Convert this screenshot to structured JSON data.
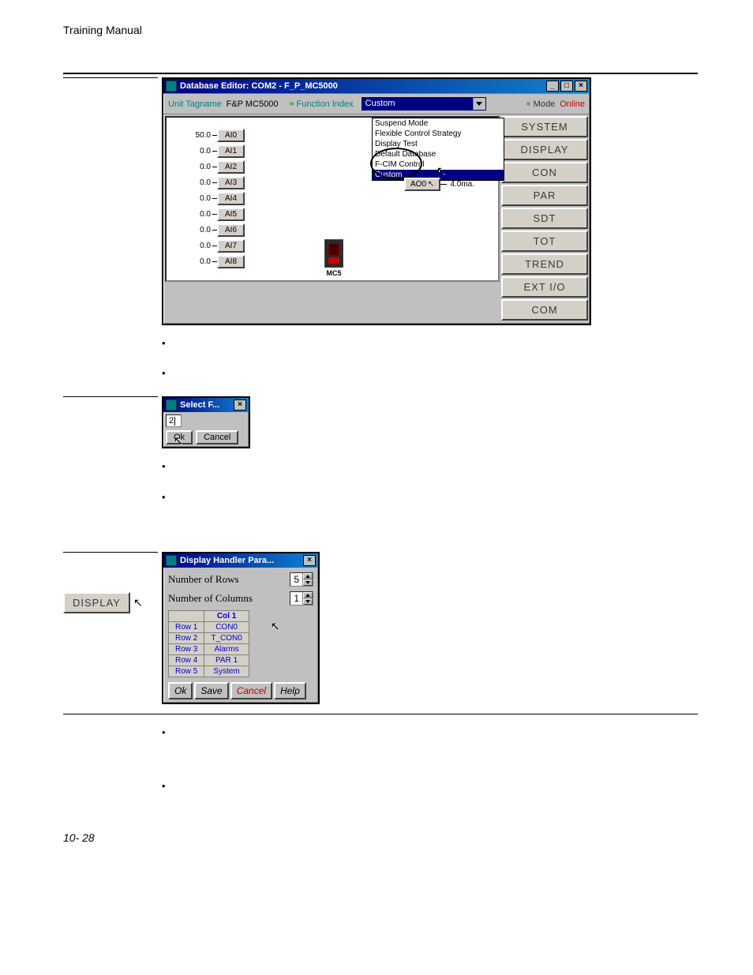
{
  "header": "Training Manual",
  "page_number": "10- 28",
  "dbe": {
    "title": "Database Editor: COM2 - F_P_MC5000",
    "unit_tagname_label": "Unit Tagname",
    "unit_tagname_value": "F&P MC5000",
    "function_index_label": "Function Index",
    "combo_selected": "Custom",
    "mode_label": "Mode",
    "mode_value": "Online",
    "ai": [
      {
        "val": "50.0",
        "name": "AI0"
      },
      {
        "val": "0.0",
        "name": "AI1"
      },
      {
        "val": "0.0",
        "name": "AI2"
      },
      {
        "val": "0.0",
        "name": "AI3"
      },
      {
        "val": "0.0",
        "name": "AI4"
      },
      {
        "val": "0.0",
        "name": "AI5"
      },
      {
        "val": "0.0",
        "name": "AI6"
      },
      {
        "val": "0.0",
        "name": "AI7"
      },
      {
        "val": "0.0",
        "name": "AI8"
      }
    ],
    "dropdown_options": [
      "Suspend Mode",
      "Flexible Control Strategy",
      "Display Test",
      "Default Database",
      "F-CIM Control",
      "Custom"
    ],
    "ao": {
      "name": "AO0",
      "val": "4.0ma."
    },
    "mc5_label": "MC5",
    "side_buttons": [
      "SYSTEM",
      "DISPLAY",
      "CON",
      "PAR",
      "SDT",
      "TOT",
      "TREND",
      "EXT I/O",
      "COM"
    ]
  },
  "sel": {
    "title": "Select F...",
    "value": "2",
    "ok": "Ok",
    "cancel": "Cancel"
  },
  "display_button": "DISPLAY",
  "dhp": {
    "title": "Display Handler Para...",
    "rows_label": "Number of Rows",
    "rows_value": "5",
    "cols_label": "Number of Columns",
    "cols_value": "1",
    "col_header": "Col 1",
    "rows": [
      {
        "r": "Row 1",
        "c": "CON0"
      },
      {
        "r": "Row 2",
        "c": "T_CON0"
      },
      {
        "r": "Row 3",
        "c": "Alarms"
      },
      {
        "r": "Row 4",
        "c": "PAR 1"
      },
      {
        "r": "Row 5",
        "c": "System"
      }
    ],
    "btns": {
      "ok": "Ok",
      "save": "Save",
      "cancel": "Cancel",
      "help": "Help"
    }
  }
}
